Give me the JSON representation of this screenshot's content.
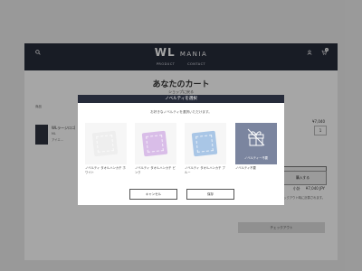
{
  "header": {
    "logo_main": "WL",
    "logo_sub": "MANIA",
    "nav": [
      "PRODUCT",
      "CONTACT"
    ],
    "cart_count": "0"
  },
  "page": {
    "title": "あなたのカート",
    "continue_link": "ショップに戻る",
    "table_header": "商品"
  },
  "product": {
    "name": "WLラージロゴ",
    "meta1": "ML",
    "meta2": "アイエ…",
    "price": "¥7,040",
    "qty": "1"
  },
  "summary": {
    "novelty_button": "ノベルティーを選択",
    "checkout_top": "購入する",
    "subtotal_label": "小計",
    "subtotal_value": "¥7,040 JPY",
    "tax_note": "税込み送料はチェックアウト時に計算されます。",
    "checkout_bottom": "チェックアウト"
  },
  "modal": {
    "title": "ノベルティを選択",
    "subtitle": "お好きなノベルティを選択いただけます。",
    "options": [
      {
        "caption": "ノベルティ タオルハンカチ ホワイト",
        "color": "#eeeeee"
      },
      {
        "caption": "ノベルティ タオルハンカチ ピンク",
        "color": "#d9bde8"
      },
      {
        "caption": "ノベルティ タオルハンカチ ブルー",
        "color": "#a9c6e6"
      },
      {
        "caption": "ノベルティ不要",
        "thumb_label": "ノベルティー不要",
        "color": "#7b859f"
      }
    ],
    "cancel_label": "キャンセル",
    "ok_label": "保存"
  }
}
